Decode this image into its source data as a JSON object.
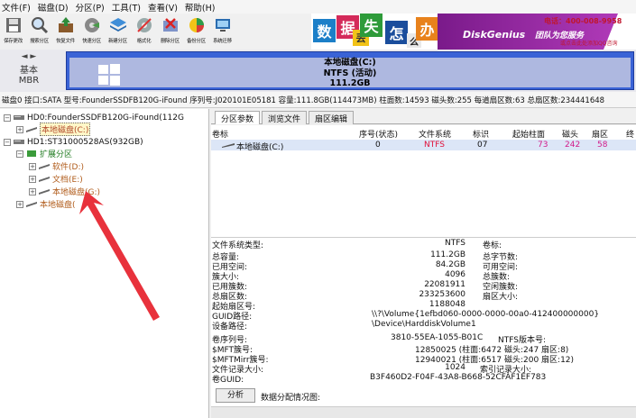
{
  "menu": [
    "文件(F)",
    "磁盘(D)",
    "分区(P)",
    "工具(T)",
    "查看(V)",
    "帮助(H)"
  ],
  "toolbar": [
    "保存更改",
    "搜索分区",
    "恢复文件",
    "快速分区",
    "新建分区",
    "格式化",
    "删除分区",
    "备份分区",
    "系统迁移"
  ],
  "banner": {
    "chars": [
      "数",
      "据",
      "丢",
      "失",
      "怎",
      "么",
      "办"
    ],
    "brand": "DiskGenius",
    "team": "团队为您服务",
    "phone": "电话：400-008-9958",
    "qq": "或点击此处添加QQ咨询"
  },
  "diskmap": {
    "nav": "◄ ►",
    "type_line1": "基本",
    "type_line2": "MBR",
    "part_name": "本地磁盘(C:)",
    "part_fs": "NTFS (活动)",
    "part_size": "111.2GB"
  },
  "infoline": "磁盘0 接口:SATA  型号:FounderSSDFB120G-iFound  序列号:J020101E05181  容量:111.8GB(114473MB)  柱面数:14593  磁头数:255  每道扇区数:63  总扇区数:234441648",
  "tree": {
    "hd0": "HD0:FounderSSDFB120G-iFound(112G",
    "hd0_c": "本地磁盘(C:)",
    "hd1": "HD1:ST31000528AS(932GB)",
    "ext": "扩展分区",
    "d": "软件(D:)",
    "e": "文档(E:)",
    "g": "本地磁盘(G:)",
    "local": "本地磁盘("
  },
  "tabs": [
    "分区参数",
    "浏览文件",
    "扇区编辑"
  ],
  "ptable": {
    "headers": [
      "卷标",
      "序号(状态)",
      "文件系统",
      "标识",
      "起始柱面",
      "磁头",
      "扇区",
      "终"
    ],
    "row": {
      "label": "本地磁盘(C:)",
      "index": "0",
      "fs": "NTFS",
      "id": "07",
      "cyl": "73",
      "head": "242",
      "sector": "58"
    }
  },
  "details": {
    "fs_type_label": "文件系统类型:",
    "fs_type": "NTFS",
    "vol_label": "卷标:",
    "total_label": "总容量:",
    "total": "111.2GB",
    "total_bytes_label": "总字节数:",
    "used_label": "已用空间:",
    "used": "84.2GB",
    "free_label": "可用空间:",
    "cluster_label": "簇大小:",
    "cluster": "4096",
    "total_clusters_label": "总簇数:",
    "used_clusters_label": "已用簇数:",
    "used_clusters": "22081911",
    "free_clusters_label": "空闲簇数:",
    "total_sectors_label": "总扇区数:",
    "total_sectors": "233253600",
    "sector_size_label": "扇区大小:",
    "start_sector_label": "起始扇区号:",
    "start_sector": "1188048",
    "guid_path_label": "GUID路径:",
    "guid_path": "\\\\?\\Volume{1efbd060-0000-0000-00a0-412400000000}",
    "dev_path_label": "设备路径:",
    "dev_path": "\\Device\\HarddiskVolume1",
    "serial_label": "卷序列号:",
    "serial": "3810-55EA-1055-B01C",
    "ntfs_ver_label": "NTFS版本号:",
    "mft_label": "$MFT簇号:",
    "mft": "12850025 (柱面:6472 磁头:247 扇区:8)",
    "mftmirr_label": "$MFTMirr簇号:",
    "mftmirr": "12940021 (柱面:6517 磁头:200 扇区:12)",
    "record_label": "文件记录大小:",
    "record": "1024",
    "index_label": "索引记录大小:",
    "guid_label": "卷GUID:",
    "guid": "B3F460D2-F04F-43A8-B668-52CFAF1EF783",
    "analyze": "分析",
    "alloc_label": "数据分配情况图:"
  },
  "colors": {
    "accent": "#3a63d6",
    "arrow": "#e8323c",
    "banner_purple": "#8b2a9a"
  }
}
